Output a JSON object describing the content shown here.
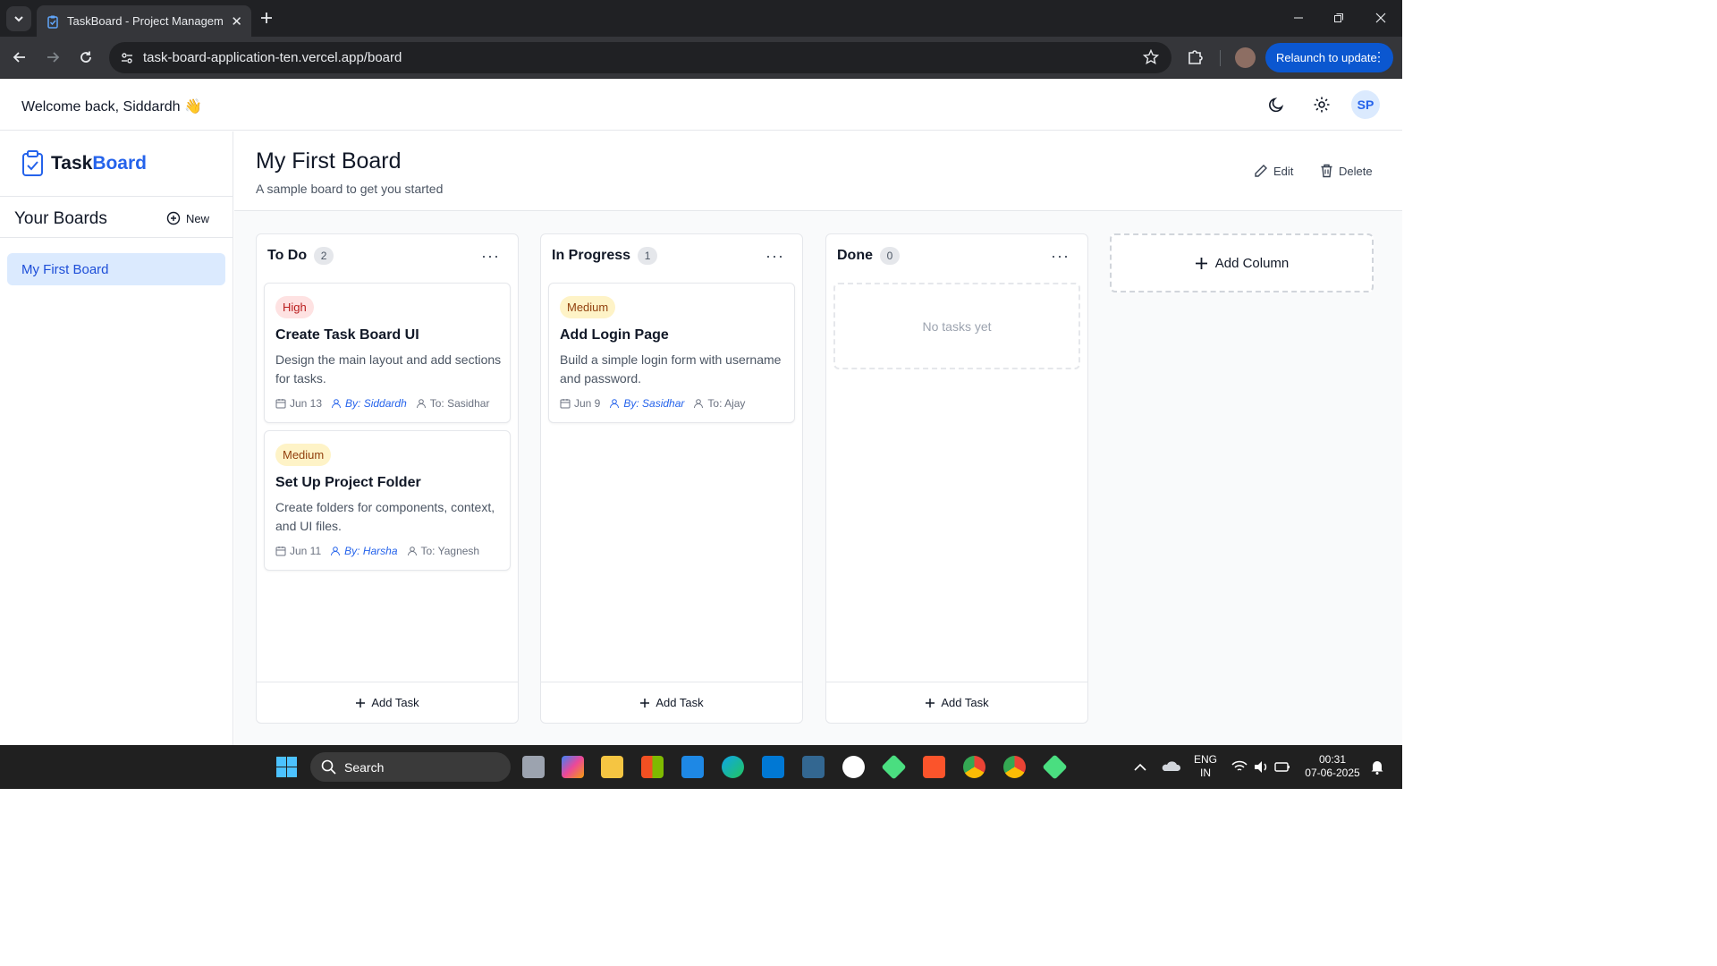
{
  "browser": {
    "tab_title": "TaskBoard - Project Management",
    "url": "task-board-application-ten.vercel.app/board",
    "relaunch_label": "Relaunch to update"
  },
  "header": {
    "welcome": "Welcome back, Siddardh 👋",
    "avatar_initials": "SP"
  },
  "sidebar": {
    "brand_part1": "Task",
    "brand_part2": "Board",
    "boards_title": "Your Boards",
    "new_label": "New",
    "boards": [
      "My First Board"
    ]
  },
  "board": {
    "title": "My First Board",
    "description": "A sample board to get you started",
    "edit_label": "Edit",
    "delete_label": "Delete",
    "add_column_label": "Add Column",
    "add_task_label": "Add Task",
    "empty_label": "No tasks yet",
    "columns": [
      {
        "title": "To Do",
        "count": "2",
        "cards": [
          {
            "priority": "High",
            "title": "Create Task Board UI",
            "description": "Design the main layout and add sections for tasks.",
            "date": "Jun 13",
            "by": "By: Siddardh",
            "to": "To: Sasidhar"
          },
          {
            "priority": "Medium",
            "title": "Set Up Project Folder",
            "description": "Create folders for components, context, and UI files.",
            "date": "Jun 11",
            "by": "By: Harsha",
            "to": "To: Yagnesh"
          }
        ]
      },
      {
        "title": "In Progress",
        "count": "1",
        "cards": [
          {
            "priority": "Medium",
            "title": "Add Login Page",
            "description": "Build a simple login form with username and password.",
            "date": "Jun 9",
            "by": "By: Sasidhar",
            "to": "To: Ajay"
          }
        ]
      },
      {
        "title": "Done",
        "count": "0",
        "cards": []
      }
    ]
  },
  "taskbar": {
    "search_label": "Search",
    "lang_line1": "ENG",
    "lang_line2": "IN",
    "time": "00:31",
    "date": "07-06-2025"
  },
  "colors": {
    "accent": "#2563eb",
    "high_badge": "#fee2e2",
    "medium_badge": "#fef3c7"
  }
}
